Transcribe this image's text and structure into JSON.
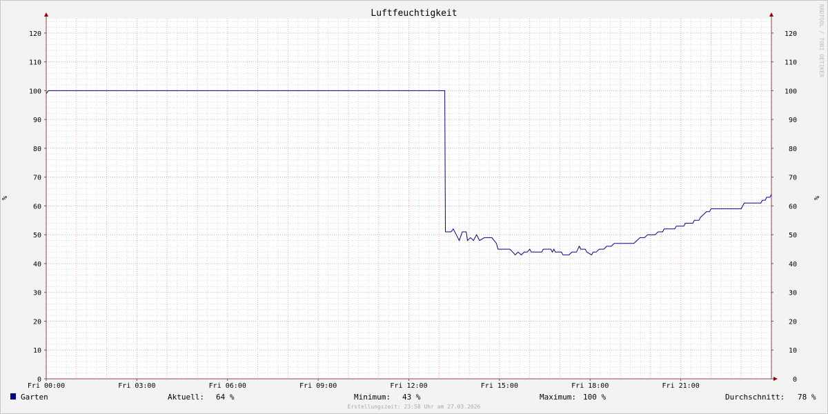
{
  "chart_data": {
    "type": "line",
    "title": "Luftfeuchtigkeit",
    "ylabel": "%",
    "ylabel_right": "%",
    "ylim": [
      0,
      125
    ],
    "yticks": [
      0,
      10,
      20,
      30,
      40,
      50,
      60,
      70,
      80,
      90,
      100,
      110,
      120
    ],
    "xlim": [
      0,
      24
    ],
    "xticks": [
      {
        "t": 0,
        "label": "Fri 00:00"
      },
      {
        "t": 3,
        "label": "Fri 03:00"
      },
      {
        "t": 6,
        "label": "Fri 06:00"
      },
      {
        "t": 9,
        "label": "Fri 09:00"
      },
      {
        "t": 12,
        "label": "Fri 12:00"
      },
      {
        "t": 15,
        "label": "Fri 15:00"
      },
      {
        "t": 18,
        "label": "Fri 18:00"
      },
      {
        "t": 21,
        "label": "Fri 21:00"
      }
    ],
    "grid": true,
    "series": [
      {
        "name": "Garten",
        "color": "#000088",
        "points": [
          [
            0.0,
            99
          ],
          [
            0.07,
            100
          ],
          [
            13.19,
            100
          ],
          [
            13.21,
            51
          ],
          [
            13.4,
            51
          ],
          [
            13.47,
            52
          ],
          [
            13.57,
            50
          ],
          [
            13.67,
            48
          ],
          [
            13.77,
            51
          ],
          [
            13.9,
            51
          ],
          [
            13.94,
            48
          ],
          [
            14.04,
            49
          ],
          [
            14.14,
            48
          ],
          [
            14.24,
            50
          ],
          [
            14.34,
            48
          ],
          [
            14.5,
            49
          ],
          [
            14.75,
            49
          ],
          [
            14.82,
            48
          ],
          [
            14.9,
            47
          ],
          [
            14.95,
            45
          ],
          [
            15.34,
            45
          ],
          [
            15.44,
            44
          ],
          [
            15.52,
            43
          ],
          [
            15.62,
            44
          ],
          [
            15.72,
            43
          ],
          [
            15.82,
            44
          ],
          [
            15.92,
            44
          ],
          [
            16.0,
            45
          ],
          [
            16.05,
            44
          ],
          [
            16.4,
            44
          ],
          [
            16.45,
            45
          ],
          [
            16.7,
            45
          ],
          [
            16.75,
            44
          ],
          [
            16.8,
            45
          ],
          [
            16.85,
            44
          ],
          [
            17.05,
            44
          ],
          [
            17.1,
            43
          ],
          [
            17.3,
            43
          ],
          [
            17.4,
            44
          ],
          [
            17.55,
            44
          ],
          [
            17.64,
            46
          ],
          [
            17.69,
            45
          ],
          [
            17.84,
            45
          ],
          [
            17.89,
            44
          ],
          [
            18.05,
            43
          ],
          [
            18.1,
            44
          ],
          [
            18.2,
            44
          ],
          [
            18.3,
            45
          ],
          [
            18.45,
            45
          ],
          [
            18.55,
            46
          ],
          [
            18.7,
            46
          ],
          [
            18.8,
            47
          ],
          [
            19.45,
            47
          ],
          [
            19.55,
            48
          ],
          [
            19.65,
            49
          ],
          [
            19.8,
            49
          ],
          [
            19.9,
            50
          ],
          [
            20.15,
            50
          ],
          [
            20.25,
            51
          ],
          [
            20.4,
            51
          ],
          [
            20.45,
            52
          ],
          [
            20.8,
            52
          ],
          [
            20.85,
            53
          ],
          [
            21.1,
            53
          ],
          [
            21.15,
            54
          ],
          [
            21.4,
            54
          ],
          [
            21.45,
            55
          ],
          [
            21.6,
            55
          ],
          [
            21.65,
            56
          ],
          [
            21.75,
            57
          ],
          [
            21.85,
            58
          ],
          [
            21.95,
            58
          ],
          [
            22.0,
            59
          ],
          [
            22.85,
            59
          ],
          [
            23.0,
            59
          ],
          [
            23.05,
            60
          ],
          [
            23.1,
            61
          ],
          [
            23.65,
            61
          ],
          [
            23.7,
            62
          ],
          [
            23.8,
            62
          ],
          [
            23.84,
            63
          ],
          [
            23.95,
            63
          ],
          [
            24.0,
            64
          ]
        ]
      }
    ]
  },
  "legend": {
    "series_name": "Garten",
    "swatch_color": "#000088",
    "current_label": "Aktuell:",
    "current_value": "64 %",
    "min_label": "Minimum:",
    "min_value": "43 %",
    "max_label": "Maximum:",
    "max_value": "100 %",
    "avg_label": "Durchschnitt:",
    "avg_value": "78 %"
  },
  "watermark": "RRDTOOL / TOBI OETIKER",
  "footer": "Erstellungszeit: 23:58 Uhr am 27.03.2026",
  "colors": {
    "major_grid": "#e6a8a8",
    "minor_grid": "#d8d8d8",
    "axis": "#8a4444",
    "arrow": "#990000",
    "plot_bg": "#ffffff"
  }
}
